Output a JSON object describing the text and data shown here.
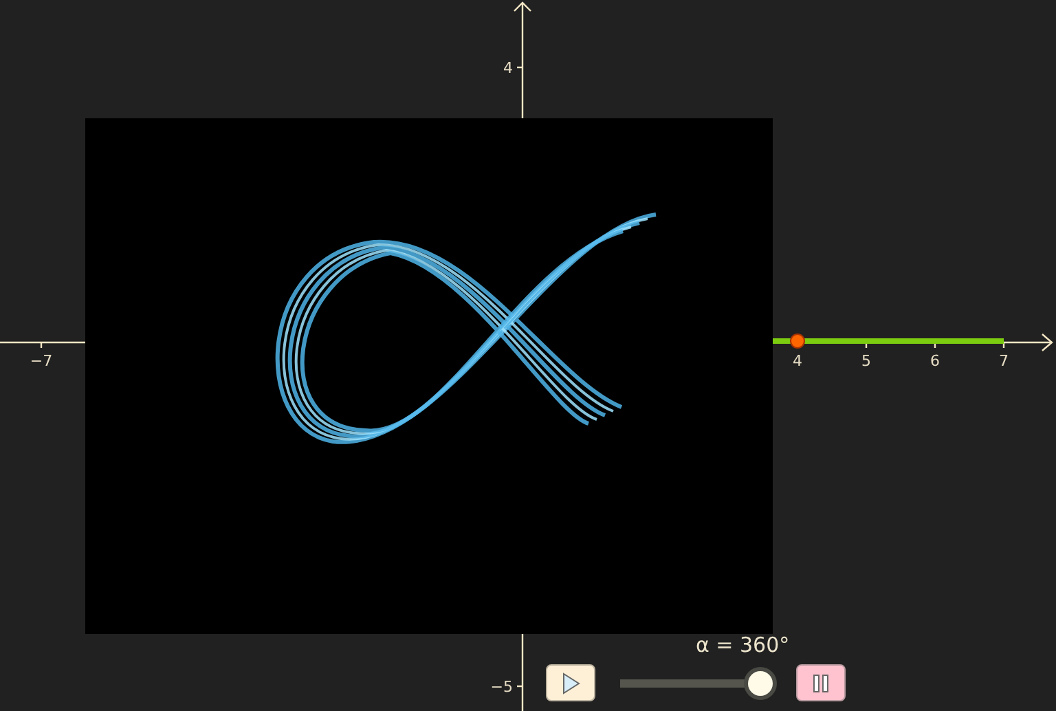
{
  "axes": {
    "x_ticks": [
      {
        "label": "−7"
      },
      {
        "label": "4"
      },
      {
        "label": "5"
      },
      {
        "label": "6"
      },
      {
        "label": "7"
      }
    ],
    "y_ticks": [
      {
        "label": "4"
      },
      {
        "label": "−5"
      }
    ]
  },
  "animation": {
    "label": "α = 360°",
    "level": 1
  }
}
